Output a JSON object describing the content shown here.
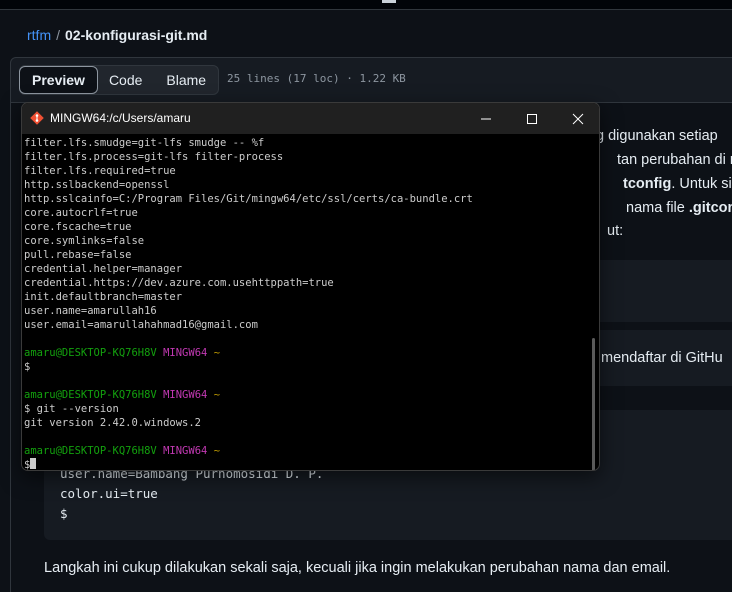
{
  "breadcrumb": {
    "repo": "rtfm",
    "separator": "/",
    "file": "02-konfigurasi-git.md"
  },
  "file_header": {
    "tabs": [
      {
        "label": "Preview",
        "active": true
      },
      {
        "label": "Code",
        "active": false
      },
      {
        "label": "Blame",
        "active": false
      }
    ],
    "info": "25 lines (17 loc) · 1.22 KB"
  },
  "doc": {
    "line1": "g digunakan setiap",
    "line2": "tan perubahan di re",
    "line3_bold": "tconfig",
    "line3_rest": ". Untuk siste",
    "line4_pre": "nama file ",
    "line4_bold": ".gitconfi",
    "line5": "ut:",
    "line6": "mendaftar di GitHu",
    "code_lines": [
      "user.name=Bambang Purnomosidi D. P.",
      "color.ui=true",
      "$"
    ],
    "footer": "Langkah ini cukup dilakukan sekali saja, kecuali jika ingin melakukan perubahan nama dan email."
  },
  "terminal": {
    "title": "MINGW64:/c/Users/amaru",
    "config_lines": [
      "filter.lfs.smudge=git-lfs smudge -- %f",
      "filter.lfs.process=git-lfs filter-process",
      "filter.lfs.required=true",
      "http.sslbackend=openssl",
      "http.sslcainfo=C:/Program Files/Git/mingw64/etc/ssl/certs/ca-bundle.crt",
      "core.autocrlf=true",
      "core.fscache=true",
      "core.symlinks=false",
      "pull.rebase=false",
      "credential.helper=manager",
      "credential.https://dev.azure.com.usehttppath=true",
      "init.defaultbranch=master",
      "user.name=amarullah16",
      "user.email=amarullahahmad16@gmail.com"
    ],
    "prompt_user": "amaru@DESKTOP-KQ76H8V",
    "prompt_sys": "MINGW64",
    "prompt_dir": "~",
    "dollar": "$",
    "command": "$ git --version",
    "output": "git version 2.42.0.windows.2",
    "colors": {
      "user": "#13a10e",
      "sys": "#c239b3",
      "dir": "#c19c00"
    }
  }
}
